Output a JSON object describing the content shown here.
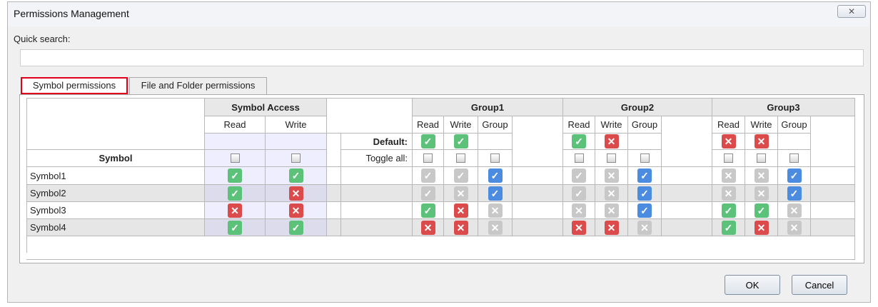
{
  "window": {
    "title": "Permissions Management",
    "close_glyph": "✕"
  },
  "search": {
    "label": "Quick search:",
    "value": "",
    "placeholder": ""
  },
  "tabs": [
    {
      "label": "Symbol permissions",
      "active": true
    },
    {
      "label": "File and Folder permissions",
      "active": false
    }
  ],
  "table": {
    "symbol_access": {
      "title": "Symbol Access",
      "sub": [
        "Read",
        "Write"
      ]
    },
    "groups": [
      {
        "name": "Group1",
        "sub": [
          "Read",
          "Write",
          "Group"
        ],
        "defaults": [
          "check-green",
          "check-green",
          ""
        ]
      },
      {
        "name": "Group2",
        "sub": [
          "Read",
          "Write",
          "Group"
        ],
        "defaults": [
          "check-green",
          "cross-red",
          ""
        ]
      },
      {
        "name": "Group3",
        "sub": [
          "Read",
          "Write",
          "Group"
        ],
        "defaults": [
          "cross-red",
          "cross-red",
          ""
        ]
      }
    ],
    "symbol_header": "Symbol",
    "default_label": "Default:",
    "toggle_label": "Toggle all:",
    "rows": [
      {
        "name": "Symbol1",
        "access": [
          "check-green",
          "check-green"
        ],
        "groups": [
          [
            "check-gray",
            "check-gray",
            "check-blue"
          ],
          [
            "check-gray",
            "cross-gray",
            "check-blue"
          ],
          [
            "cross-gray",
            "cross-gray",
            "check-blue"
          ]
        ]
      },
      {
        "name": "Symbol2",
        "access": [
          "check-green",
          "cross-red"
        ],
        "groups": [
          [
            "check-gray",
            "cross-gray",
            "check-blue"
          ],
          [
            "check-gray",
            "cross-gray",
            "check-blue"
          ],
          [
            "cross-gray",
            "cross-gray",
            "check-blue"
          ]
        ]
      },
      {
        "name": "Symbol3",
        "access": [
          "cross-red",
          "cross-red"
        ],
        "groups": [
          [
            "check-green",
            "cross-red",
            "cross-gray"
          ],
          [
            "cross-gray",
            "cross-gray",
            "check-blue"
          ],
          [
            "check-green",
            "check-green",
            "cross-gray"
          ]
        ]
      },
      {
        "name": "Symbol4",
        "access": [
          "check-green",
          "check-green"
        ],
        "groups": [
          [
            "cross-red",
            "cross-red",
            "cross-gray"
          ],
          [
            "cross-red",
            "cross-red",
            "cross-gray"
          ],
          [
            "check-green",
            "cross-red",
            "cross-gray"
          ]
        ]
      }
    ]
  },
  "buttons": {
    "ok": "OK",
    "cancel": "Cancel"
  },
  "colors": {
    "check_green": "#5cc27a",
    "cross_red": "#db4b4b",
    "check_blue": "#4b8be0",
    "disabled_gray": "#c8c8c8",
    "tab_highlight": "#e0001a"
  }
}
